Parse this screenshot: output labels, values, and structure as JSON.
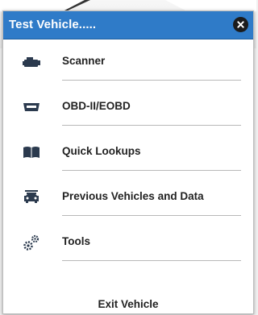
{
  "dialog": {
    "title": "Test Vehicle.....",
    "close_icon": "close-icon"
  },
  "menu": {
    "items": [
      {
        "label": "Scanner",
        "icon": "engine-icon"
      },
      {
        "label": "OBD-II/EOBD",
        "icon": "obd-connector-icon"
      },
      {
        "label": "Quick Lookups",
        "icon": "book-icon"
      },
      {
        "label": "Previous Vehicles and Data",
        "icon": "vehicle-history-icon"
      },
      {
        "label": "Tools",
        "icon": "gears-icon"
      }
    ],
    "exit_label": "Exit Vehicle"
  },
  "colors": {
    "header": "#2f7bc8",
    "icon": "#2b3a4e"
  }
}
